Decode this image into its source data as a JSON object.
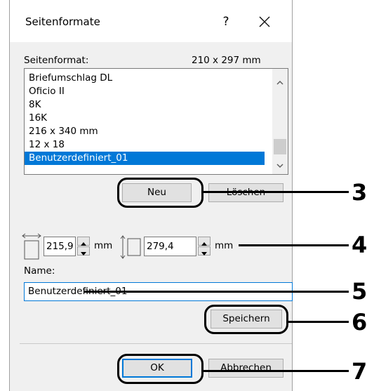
{
  "window": {
    "title": "Seitenformate",
    "help_label": "?",
    "close_icon": "close-icon"
  },
  "page_format": {
    "label": "Seitenformat:",
    "current_size": "210 x 297 mm",
    "items": [
      {
        "label": "Briefumschlag DL",
        "selected": false
      },
      {
        "label": "Oficio II",
        "selected": false
      },
      {
        "label": "8K",
        "selected": false
      },
      {
        "label": "16K",
        "selected": false
      },
      {
        "label": "216 x 340 mm",
        "selected": false
      },
      {
        "label": "12 x 18",
        "selected": false
      },
      {
        "label": "Benutzerdefiniert_01",
        "selected": true
      }
    ]
  },
  "buttons": {
    "new": "Neu",
    "delete": "Löschen",
    "save": "Speichern",
    "ok": "OK",
    "cancel": "Abbrechen"
  },
  "dimensions": {
    "width_value": "215,9",
    "width_unit": "mm",
    "height_value": "279,4",
    "height_unit": "mm"
  },
  "name": {
    "label": "Name:",
    "value": "Benutzerdefiniert_01"
  },
  "callouts": [
    "3",
    "4",
    "5",
    "6",
    "7"
  ],
  "colors": {
    "accent": "#0078d7",
    "dialog_bg": "#f0f0f0",
    "button_bg": "#e1e1e1"
  }
}
